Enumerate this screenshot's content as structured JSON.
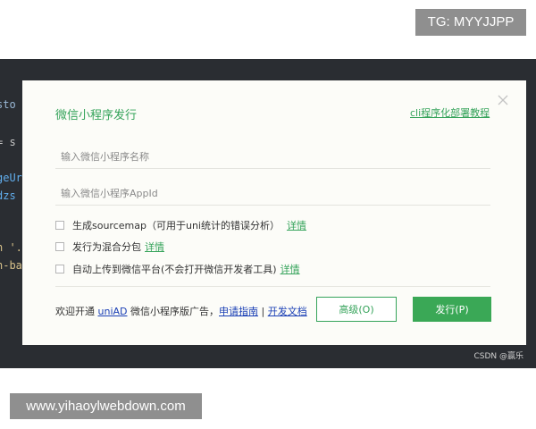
{
  "watermarks": {
    "tg": "TG: MYYJJPP",
    "url": "www.yihaoylwebdown.com",
    "csdn": "CSDN @赢乐"
  },
  "editor_snippets": [
    "sto",
    "= s",
    "geUr",
    "dzs",
    "n '.",
    "n-ba"
  ],
  "dialog": {
    "title": "微信小程序发行",
    "cli_link": "cli程序化部署教程",
    "name_input": {
      "value": "",
      "placeholder": "输入微信小程序名称"
    },
    "appid_input": {
      "value": "",
      "placeholder": "输入微信小程序AppId"
    },
    "options": [
      {
        "label": "生成sourcemap（可用于uni统计的错误分析）",
        "link": "详情",
        "checked": false
      },
      {
        "label": "发行为混合分包",
        "link": "详情",
        "checked": false
      },
      {
        "label": "自动上传到微信平台(不会打开微信开发者工具)",
        "link": "详情",
        "checked": false
      }
    ],
    "footer": {
      "prefix": "欢迎开通 ",
      "uniad": "uniAD",
      "middle": " 微信小程序版广告，",
      "apply": "申请指南",
      "sep": " | ",
      "docs": "开发文档"
    },
    "buttons": {
      "advanced": "高级(O)",
      "publish": "发行(P)"
    }
  },
  "colors": {
    "accent_green": "#35a35a",
    "publish_green": "#3aa856",
    "link_blue": "#1a3fb5",
    "editor_bg": "#2a2d32"
  }
}
